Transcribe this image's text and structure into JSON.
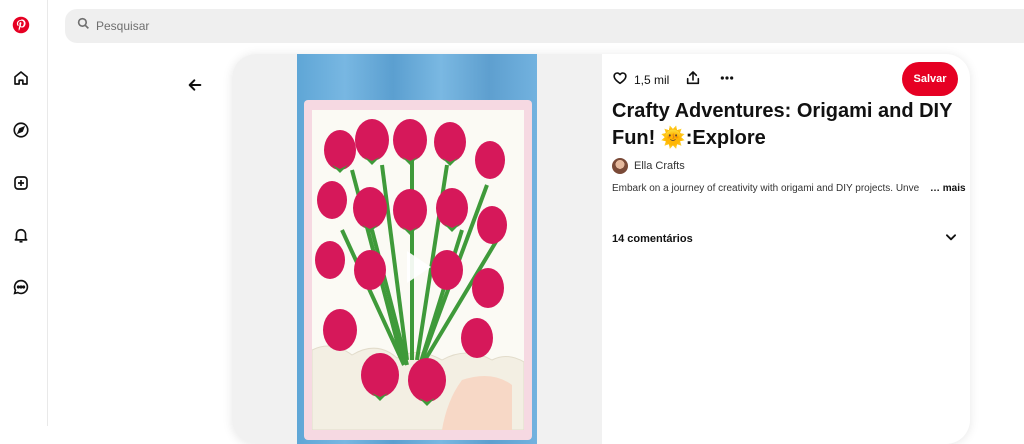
{
  "brand": {
    "logo_icon": "pinterest-logo-icon",
    "color": "#e60023"
  },
  "sidebar": {
    "items": [
      {
        "icon": "home-icon",
        "name": "home"
      },
      {
        "icon": "compass-icon",
        "name": "explore"
      },
      {
        "icon": "create-plus-icon",
        "name": "create"
      },
      {
        "icon": "bell-icon",
        "name": "notifications"
      },
      {
        "icon": "chat-icon",
        "name": "messages"
      }
    ]
  },
  "search": {
    "placeholder": "Pesquisar",
    "value": ""
  },
  "pin": {
    "like_count": "1,5 mil",
    "save_label": "Salvar",
    "title": "Crafty Adventures: Origami and DIY Fun! 🌞:Explore",
    "author": "Ella Crafts",
    "description": "Embark on a journey of creativity with origami and DIY projects. Unve",
    "more_label": "… mais",
    "comments_label": "14 comentários"
  },
  "colors": {
    "accent": "#e60023",
    "search_bg": "#efefef",
    "flower": "#d6185a",
    "leaf": "#3f9a3a"
  }
}
